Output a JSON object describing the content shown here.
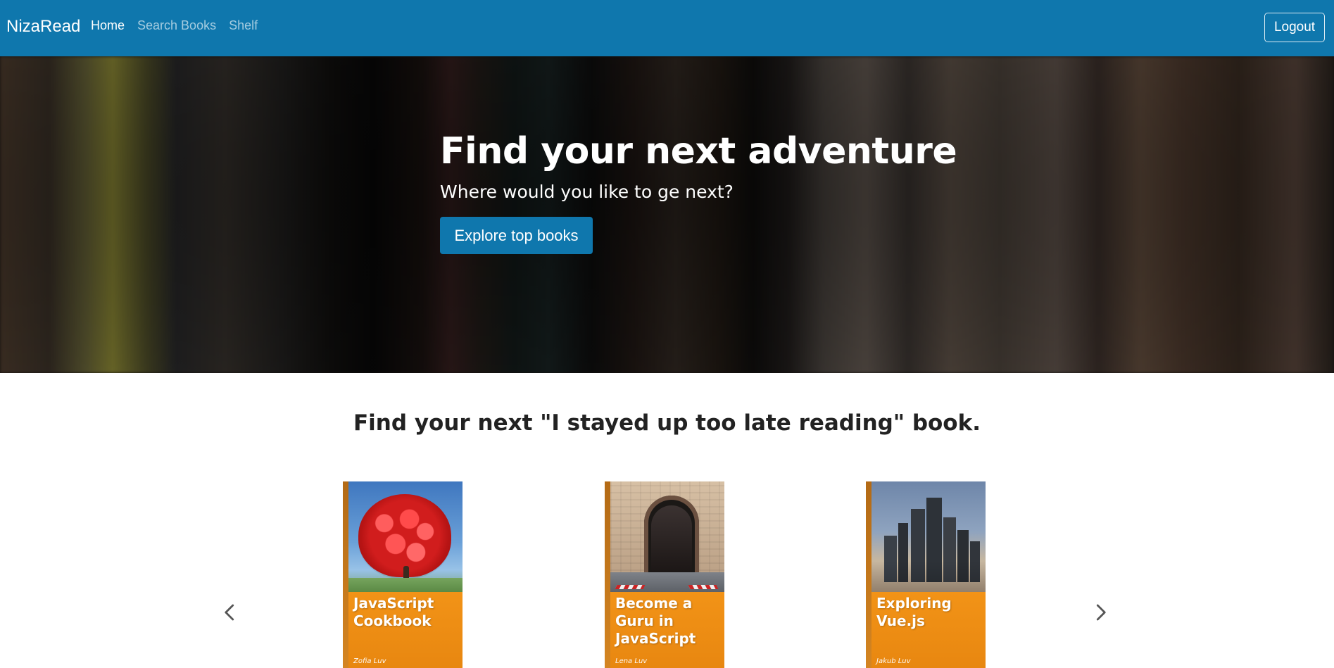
{
  "navbar": {
    "brand": "NizaRead",
    "links": [
      {
        "label": "Home",
        "active": true
      },
      {
        "label": "Search Books",
        "active": false
      },
      {
        "label": "Shelf",
        "active": false
      }
    ],
    "logout_label": "Logout",
    "colors": {
      "bar": "#0f77ad",
      "text": "#ffffff"
    }
  },
  "hero": {
    "title": "Find your next adventure",
    "subtitle": "Where would you like to ge next?",
    "cta_label": "Explore top books",
    "colors": {
      "button": "#0f77ad"
    }
  },
  "main": {
    "heading": "Find your next \"I stayed up too late reading\" book.",
    "carousel": {
      "prev_icon": "chevron-left-icon",
      "next_icon": "chevron-right-icon",
      "books": [
        {
          "title": "JavaScript Cookbook",
          "author": "Zofia Luv",
          "cover_art": "red-tree-art"
        },
        {
          "title": "Become a Guru in JavaScript",
          "author": "Lena Luv",
          "cover_art": "stone-archway-art"
        },
        {
          "title": "Exploring Vue.js",
          "author": "Jakub Luv",
          "cover_art": "city-skyline-art"
        }
      ]
    }
  }
}
